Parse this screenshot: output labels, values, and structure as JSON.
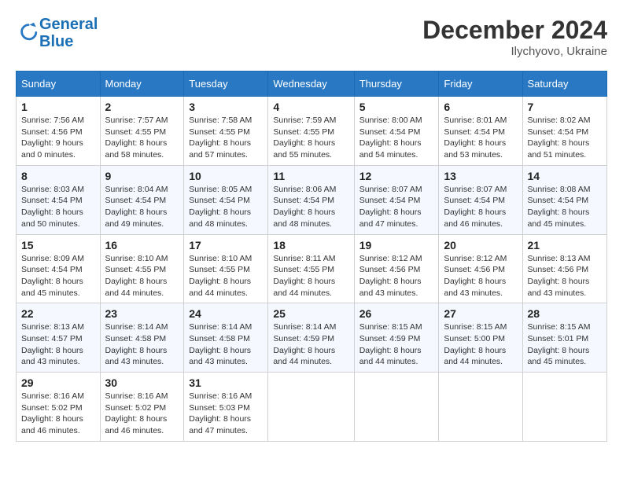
{
  "logo": {
    "line1": "General",
    "line2": "Blue"
  },
  "title": "December 2024",
  "location": "Ilychyovo, Ukraine",
  "days_header": [
    "Sunday",
    "Monday",
    "Tuesday",
    "Wednesday",
    "Thursday",
    "Friday",
    "Saturday"
  ],
  "weeks": [
    [
      {
        "day": "1",
        "info": "Sunrise: 7:56 AM\nSunset: 4:56 PM\nDaylight: 9 hours\nand 0 minutes."
      },
      {
        "day": "2",
        "info": "Sunrise: 7:57 AM\nSunset: 4:55 PM\nDaylight: 8 hours\nand 58 minutes."
      },
      {
        "day": "3",
        "info": "Sunrise: 7:58 AM\nSunset: 4:55 PM\nDaylight: 8 hours\nand 57 minutes."
      },
      {
        "day": "4",
        "info": "Sunrise: 7:59 AM\nSunset: 4:55 PM\nDaylight: 8 hours\nand 55 minutes."
      },
      {
        "day": "5",
        "info": "Sunrise: 8:00 AM\nSunset: 4:54 PM\nDaylight: 8 hours\nand 54 minutes."
      },
      {
        "day": "6",
        "info": "Sunrise: 8:01 AM\nSunset: 4:54 PM\nDaylight: 8 hours\nand 53 minutes."
      },
      {
        "day": "7",
        "info": "Sunrise: 8:02 AM\nSunset: 4:54 PM\nDaylight: 8 hours\nand 51 minutes."
      }
    ],
    [
      {
        "day": "8",
        "info": "Sunrise: 8:03 AM\nSunset: 4:54 PM\nDaylight: 8 hours\nand 50 minutes."
      },
      {
        "day": "9",
        "info": "Sunrise: 8:04 AM\nSunset: 4:54 PM\nDaylight: 8 hours\nand 49 minutes."
      },
      {
        "day": "10",
        "info": "Sunrise: 8:05 AM\nSunset: 4:54 PM\nDaylight: 8 hours\nand 48 minutes."
      },
      {
        "day": "11",
        "info": "Sunrise: 8:06 AM\nSunset: 4:54 PM\nDaylight: 8 hours\nand 48 minutes."
      },
      {
        "day": "12",
        "info": "Sunrise: 8:07 AM\nSunset: 4:54 PM\nDaylight: 8 hours\nand 47 minutes."
      },
      {
        "day": "13",
        "info": "Sunrise: 8:07 AM\nSunset: 4:54 PM\nDaylight: 8 hours\nand 46 minutes."
      },
      {
        "day": "14",
        "info": "Sunrise: 8:08 AM\nSunset: 4:54 PM\nDaylight: 8 hours\nand 45 minutes."
      }
    ],
    [
      {
        "day": "15",
        "info": "Sunrise: 8:09 AM\nSunset: 4:54 PM\nDaylight: 8 hours\nand 45 minutes."
      },
      {
        "day": "16",
        "info": "Sunrise: 8:10 AM\nSunset: 4:55 PM\nDaylight: 8 hours\nand 44 minutes."
      },
      {
        "day": "17",
        "info": "Sunrise: 8:10 AM\nSunset: 4:55 PM\nDaylight: 8 hours\nand 44 minutes."
      },
      {
        "day": "18",
        "info": "Sunrise: 8:11 AM\nSunset: 4:55 PM\nDaylight: 8 hours\nand 44 minutes."
      },
      {
        "day": "19",
        "info": "Sunrise: 8:12 AM\nSunset: 4:56 PM\nDaylight: 8 hours\nand 43 minutes."
      },
      {
        "day": "20",
        "info": "Sunrise: 8:12 AM\nSunset: 4:56 PM\nDaylight: 8 hours\nand 43 minutes."
      },
      {
        "day": "21",
        "info": "Sunrise: 8:13 AM\nSunset: 4:56 PM\nDaylight: 8 hours\nand 43 minutes."
      }
    ],
    [
      {
        "day": "22",
        "info": "Sunrise: 8:13 AM\nSunset: 4:57 PM\nDaylight: 8 hours\nand 43 minutes."
      },
      {
        "day": "23",
        "info": "Sunrise: 8:14 AM\nSunset: 4:58 PM\nDaylight: 8 hours\nand 43 minutes."
      },
      {
        "day": "24",
        "info": "Sunrise: 8:14 AM\nSunset: 4:58 PM\nDaylight: 8 hours\nand 43 minutes."
      },
      {
        "day": "25",
        "info": "Sunrise: 8:14 AM\nSunset: 4:59 PM\nDaylight: 8 hours\nand 44 minutes."
      },
      {
        "day": "26",
        "info": "Sunrise: 8:15 AM\nSunset: 4:59 PM\nDaylight: 8 hours\nand 44 minutes."
      },
      {
        "day": "27",
        "info": "Sunrise: 8:15 AM\nSunset: 5:00 PM\nDaylight: 8 hours\nand 44 minutes."
      },
      {
        "day": "28",
        "info": "Sunrise: 8:15 AM\nSunset: 5:01 PM\nDaylight: 8 hours\nand 45 minutes."
      }
    ],
    [
      {
        "day": "29",
        "info": "Sunrise: 8:16 AM\nSunset: 5:02 PM\nDaylight: 8 hours\nand 46 minutes."
      },
      {
        "day": "30",
        "info": "Sunrise: 8:16 AM\nSunset: 5:02 PM\nDaylight: 8 hours\nand 46 minutes."
      },
      {
        "day": "31",
        "info": "Sunrise: 8:16 AM\nSunset: 5:03 PM\nDaylight: 8 hours\nand 47 minutes."
      },
      {
        "day": "",
        "info": ""
      },
      {
        "day": "",
        "info": ""
      },
      {
        "day": "",
        "info": ""
      },
      {
        "day": "",
        "info": ""
      }
    ]
  ]
}
